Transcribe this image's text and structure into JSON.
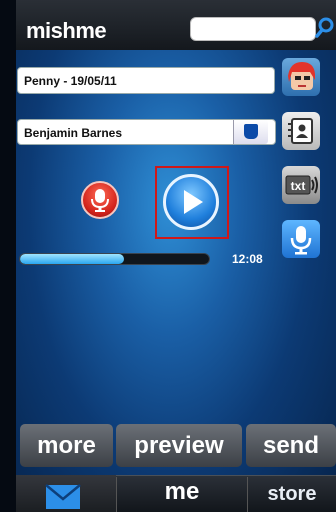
{
  "app": {
    "name": "mishme"
  },
  "message": {
    "title": "Penny - 19/05/11"
  },
  "recipient": {
    "name": "Benjamin Barnes"
  },
  "player": {
    "time": "12:08",
    "progress": 0.55
  },
  "actions": {
    "more": "more",
    "preview": "preview",
    "send": "send"
  },
  "tabs": {
    "me": "me",
    "store": "store"
  },
  "colors": {
    "accent": "#1f7fdc",
    "record": "#d2231b",
    "highlight": "#d01818"
  },
  "icons": [
    "search-icon",
    "avatar",
    "contacts-icon",
    "txt-icon",
    "voice-icon",
    "record-icon",
    "play-icon",
    "mail-icon"
  ]
}
